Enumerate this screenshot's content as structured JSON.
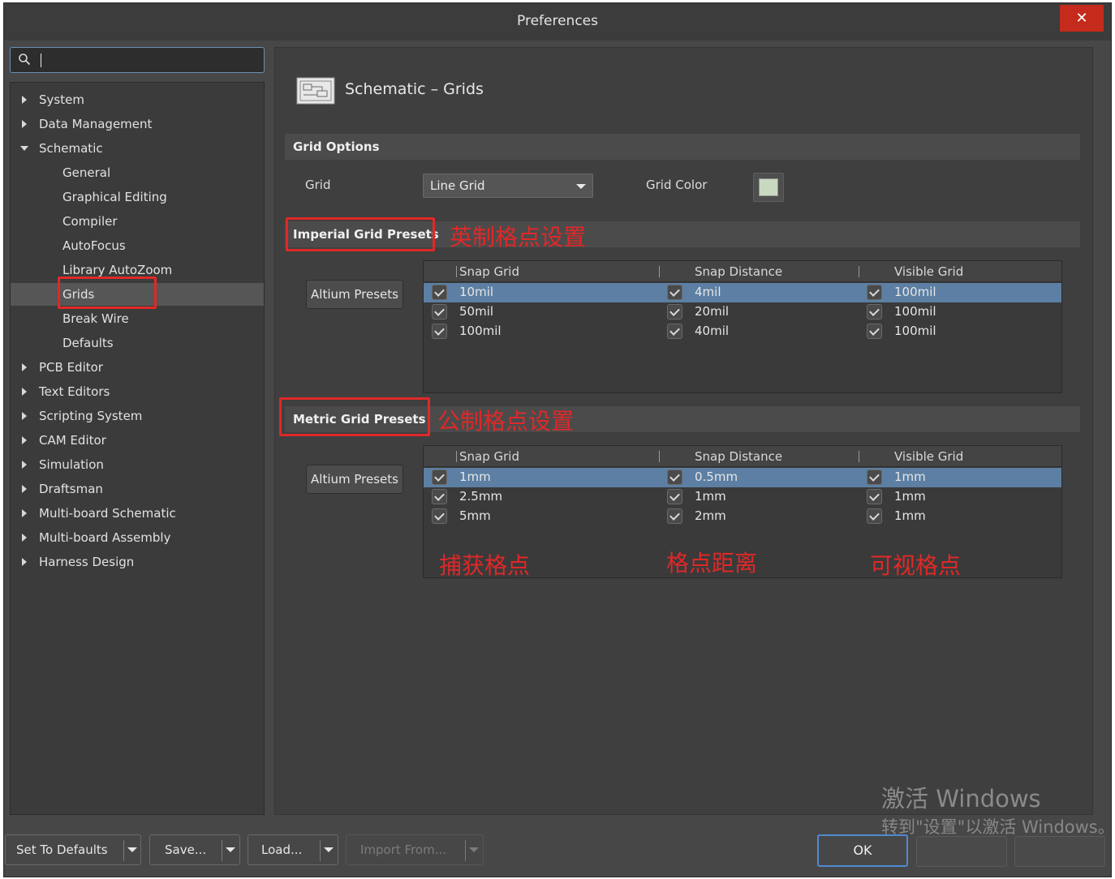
{
  "window": {
    "title": "Preferences",
    "close_label": "✕"
  },
  "search": {
    "value": ""
  },
  "tree": [
    {
      "label": "System",
      "level": 0,
      "expanded": false
    },
    {
      "label": "Data Management",
      "level": 0,
      "expanded": false
    },
    {
      "label": "Schematic",
      "level": 0,
      "expanded": true
    },
    {
      "label": "General",
      "level": 1
    },
    {
      "label": "Graphical Editing",
      "level": 1
    },
    {
      "label": "Compiler",
      "level": 1
    },
    {
      "label": "AutoFocus",
      "level": 1
    },
    {
      "label": "Library AutoZoom",
      "level": 1
    },
    {
      "label": "Grids",
      "level": 1,
      "selected": true
    },
    {
      "label": "Break Wire",
      "level": 1
    },
    {
      "label": "Defaults",
      "level": 1
    },
    {
      "label": "PCB Editor",
      "level": 0,
      "expanded": false
    },
    {
      "label": "Text Editors",
      "level": 0,
      "expanded": false
    },
    {
      "label": "Scripting System",
      "level": 0,
      "expanded": false
    },
    {
      "label": "CAM Editor",
      "level": 0,
      "expanded": false
    },
    {
      "label": "Simulation",
      "level": 0,
      "expanded": false
    },
    {
      "label": "Draftsman",
      "level": 0,
      "expanded": false
    },
    {
      "label": "Multi-board Schematic",
      "level": 0,
      "expanded": false
    },
    {
      "label": "Multi-board Assembly",
      "level": 0,
      "expanded": false
    },
    {
      "label": "Harness Design",
      "level": 0,
      "expanded": false
    }
  ],
  "page": {
    "title": "Schematic – Grids"
  },
  "grid_options": {
    "section_title": "Grid Options",
    "grid_label": "Grid",
    "grid_value": "Line Grid",
    "grid_color_label": "Grid Color",
    "grid_color": "#c8d9c0"
  },
  "imperial": {
    "section_title": "Imperial Grid Presets",
    "annotation": "英制格点设置",
    "preset_button": "Altium Presets",
    "columns": [
      "Snap Grid",
      "Snap Distance",
      "Visible Grid"
    ],
    "rows": [
      {
        "snap": "10mil",
        "distance": "4mil",
        "visible": "100mil",
        "selected": true
      },
      {
        "snap": "50mil",
        "distance": "20mil",
        "visible": "100mil"
      },
      {
        "snap": "100mil",
        "distance": "40mil",
        "visible": "100mil"
      }
    ]
  },
  "metric": {
    "section_title": "Metric Grid Presets",
    "annotation": "公制格点设置",
    "preset_button": "Altium Presets",
    "columns": [
      "Snap Grid",
      "Snap Distance",
      "Visible Grid"
    ],
    "rows": [
      {
        "snap": "1mm",
        "distance": "0.5mm",
        "visible": "1mm",
        "selected": true
      },
      {
        "snap": "2.5mm",
        "distance": "1mm",
        "visible": "1mm"
      },
      {
        "snap": "5mm",
        "distance": "2mm",
        "visible": "1mm"
      }
    ],
    "column_notes": [
      "捕获格点",
      "格点距离",
      "可视格点"
    ]
  },
  "footer": {
    "set_defaults": "Set To Defaults",
    "save": "Save...",
    "load": "Load...",
    "import_from": "Import From...",
    "ok": "OK"
  },
  "watermark": {
    "line1": "激活 Windows",
    "line2": "转到\"设置\"以激活 Windows。"
  },
  "colors": {
    "accent": "#4f8ad2",
    "selection": "#5c7fa3",
    "annotation": "#e02828",
    "close": "#c42b1c"
  }
}
